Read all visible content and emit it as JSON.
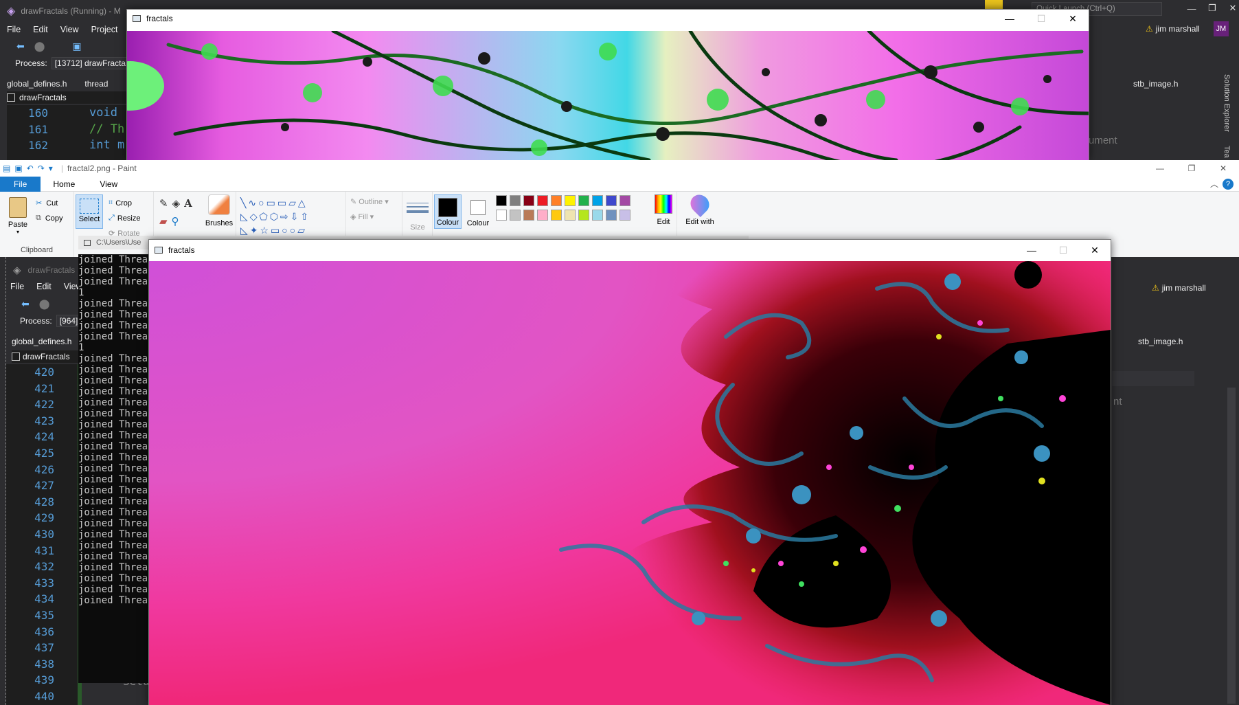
{
  "vs_top": {
    "title": "drawFractals (Running) - M",
    "menu": [
      "File",
      "Edit",
      "View",
      "Project"
    ],
    "process_label": "Process:",
    "process_value": "[13712] drawFractals",
    "tab1": "global_defines.h",
    "tab2": "thread",
    "solution": "drawFractals",
    "quick_launch": "Quick Launch (Ctrl+Q)",
    "user": "jim marshall",
    "user_initials": "JM",
    "right_tab": "stb_image.h",
    "lines": [
      "160",
      "161",
      "162"
    ],
    "code": [
      "void",
      "// Th",
      "int m"
    ],
    "solution_explorer": "Solution Explorer",
    "team": "Tea",
    "right_ghost": "ument"
  },
  "fractal_top": {
    "title": "fractals"
  },
  "paint": {
    "title": "fractal2.png - Paint",
    "tabs": [
      "File",
      "Home",
      "View"
    ],
    "paste": "Paste",
    "cut": "Cut",
    "copy": "Copy",
    "clipboard": "Clipboard",
    "select": "Select",
    "crop": "Crop",
    "resize": "Resize",
    "rotate": "Rotate",
    "brushes": "Brushes",
    "outline": "Outline",
    "fill": "Fill",
    "size": "Size",
    "colour1": "Colour",
    "colour2": "Colour",
    "edit_colours": "Edit",
    "edit_with": "Edit with",
    "path": "C:\\Users\\Use",
    "palette_row1": [
      "#000000",
      "#7f7f7f",
      "#880015",
      "#ed1c24",
      "#ff7f27",
      "#fff200",
      "#22b14c",
      "#00a2e8",
      "#3f48cc",
      "#a349a4"
    ],
    "palette_row2": [
      "#ffffff",
      "#c3c3c3",
      "#b97a57",
      "#ffaec9",
      "#ffc90e",
      "#efe4b0",
      "#b5e61d",
      "#99d9ea",
      "#7092be",
      "#c8bfe7"
    ]
  },
  "vs_bottom": {
    "title": "drawFractals",
    "menu": [
      "File",
      "Edit",
      "View"
    ],
    "process_label": "Process:",
    "process_value": "[964]",
    "tab1": "global_defines.h",
    "solution": "drawFractals",
    "user": "jim marshall",
    "right_tab": "stb_image.h",
    "right_ghost": "nt",
    "lines": [
      "420",
      "421",
      "422",
      "423",
      "424",
      "425",
      "426",
      "427",
      "428",
      "429",
      "430",
      "431",
      "432",
      "433",
      "434",
      "435",
      "436",
      "437",
      "438",
      "439",
      "440"
    ],
    "ghost_code": "Setu"
  },
  "console": {
    "lines": [
      "joined Thread",
      "joined Thread",
      "joined Thread",
      "1",
      "joined Thread",
      "joined Thread",
      "joined Thread",
      "joined Thread",
      "1",
      "joined Thread",
      "joined Thread",
      "joined Thread",
      "joined Thread",
      "joined Thread",
      "joined Thread",
      "joined Thread",
      "joined Thread",
      "joined Thread",
      "joined Thread",
      "joined Thread",
      "joined Thread",
      "joined Thread",
      "joined Thread",
      "joined Thread",
      "joined Thread",
      "joined Thread",
      "joined Thread",
      "joined Thread",
      "joined Thread",
      "joined Thread",
      "joined Thread",
      "joined Thread"
    ]
  },
  "fractal_main": {
    "title": "fractals"
  }
}
